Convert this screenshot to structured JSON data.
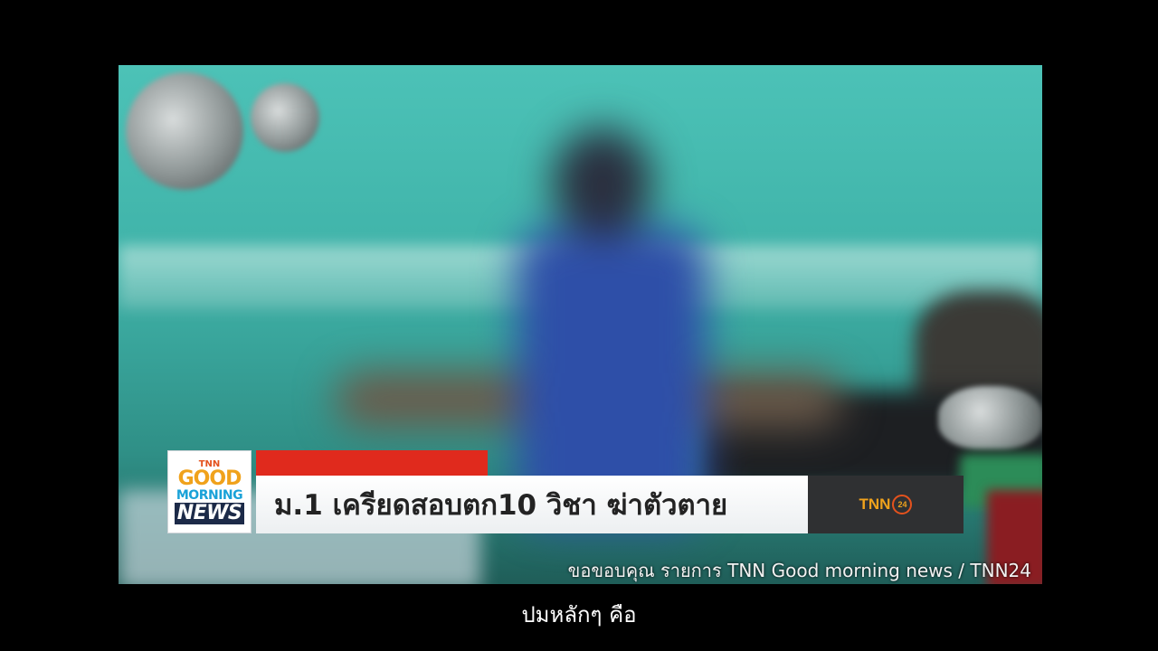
{
  "video": {
    "logo": {
      "tnn": "TNN",
      "good": "GOOD",
      "morning": "MORNING",
      "news": "NEWS"
    },
    "headline": "ม.1 เครียดสอบตก10 วิชา ฆ่าตัวตาย",
    "channel": {
      "tnn": "TNN",
      "num": "24"
    },
    "credit": "ขอขอบคุณ รายการ TNN Good morning news / TNN24"
  },
  "subtitle": "ปมหลักๆ คือ",
  "colors": {
    "accent_red": "#e02a1d",
    "logo_orange": "#f0a21c",
    "logo_blue": "#1aa2d8",
    "logo_navy": "#1c2a48"
  }
}
